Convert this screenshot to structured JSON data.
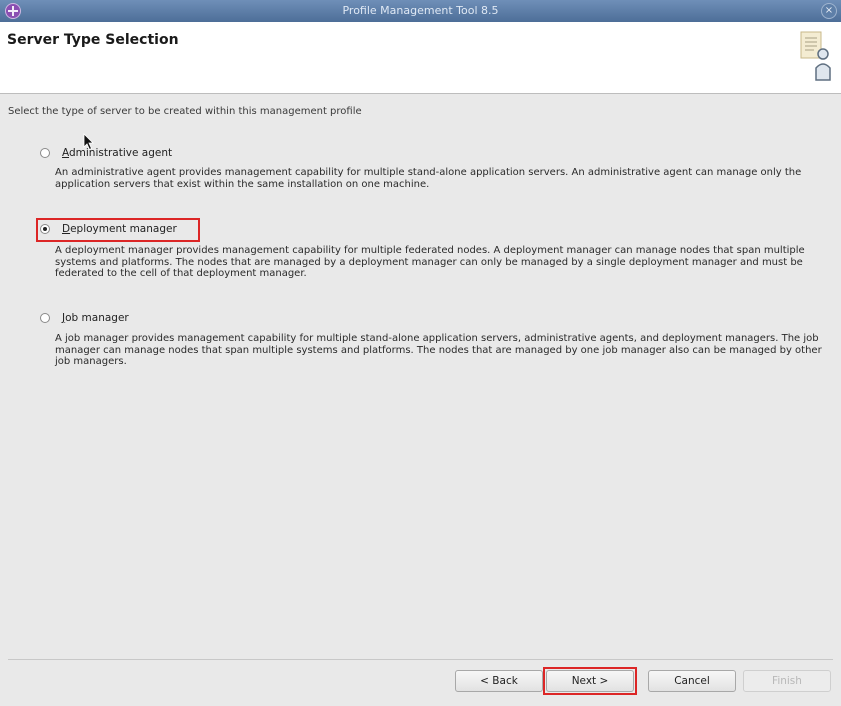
{
  "window": {
    "title": "Profile Management Tool 8.5",
    "close_glyph": "×",
    "app_icon": "pmt-app-icon"
  },
  "header": {
    "title": "Server Type Selection",
    "graphic": "document-person-icon"
  },
  "main": {
    "description": "Select the type of server to be created within this management profile",
    "options": [
      {
        "label": "Administrative agent",
        "selected": false,
        "description": "An administrative agent provides management capability for multiple stand-alone application servers. An administrative agent can manage only the application servers that exist within the same installation on one machine."
      },
      {
        "label": "Deployment manager",
        "selected": true,
        "description": "A deployment manager provides management capability for multiple federated nodes. A deployment manager can manage nodes that span multiple systems and platforms. The nodes that are managed by a deployment manager can only be managed by a single deployment manager and must be federated to the cell of that deployment manager."
      },
      {
        "label": "Job manager",
        "selected": false,
        "description": "A job manager provides management capability for multiple stand-alone application servers, administrative agents, and deployment managers. The job manager can manage nodes that span multiple systems and platforms. The nodes that are managed by one job manager also can be managed by other job managers."
      }
    ]
  },
  "footer": {
    "back_label": "< Back",
    "next_label": "Next >",
    "cancel_label": "Cancel",
    "finish_label": "Finish"
  },
  "colors": {
    "titlebar": "#5a7aa5",
    "highlight": "#dc2626",
    "dialog_bg": "#e9e9e9"
  }
}
